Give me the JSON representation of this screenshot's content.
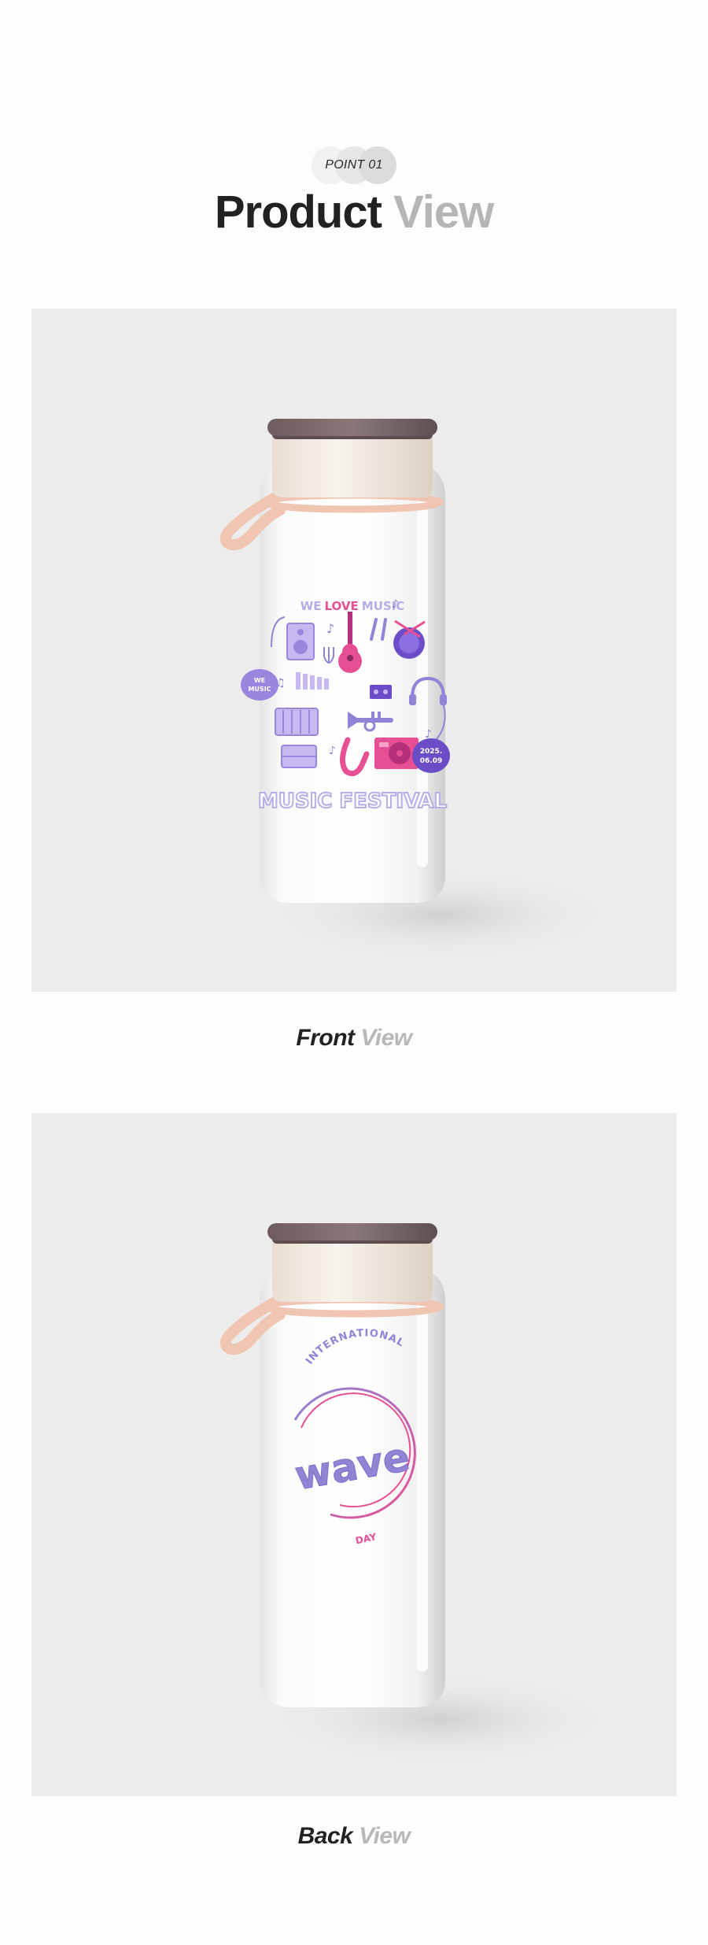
{
  "header": {
    "point_label": "POINT 01",
    "title_main": "Product",
    "title_accent": "View"
  },
  "front": {
    "caption_main": "Front",
    "caption_accent": "View",
    "print": {
      "top_word1": "WE",
      "top_word2": "LOVE",
      "top_word3": "MUSIC",
      "bubble_left_line1": "WE",
      "bubble_left_line2": "MUSIC",
      "date_line1": "2025.",
      "date_line2": "06.09",
      "bottom_text": "MUSIC FESTIVAL"
    }
  },
  "back": {
    "caption_main": "Back",
    "caption_accent": "View",
    "print": {
      "arc_top": "INTERNATIONAL",
      "center": "wave",
      "arc_bottom": "DAY"
    }
  },
  "colors": {
    "background": "#fdfdfd",
    "panel": "#ececec",
    "title_dark": "#222222",
    "title_grey": "#b5b5b5",
    "lid": "#7d6a6b",
    "collar": "#f3ece4",
    "strap": "#f0c6b2",
    "bottle": "#ffffff",
    "print_purple": "#8f84d6",
    "print_pink": "#e64f93"
  }
}
